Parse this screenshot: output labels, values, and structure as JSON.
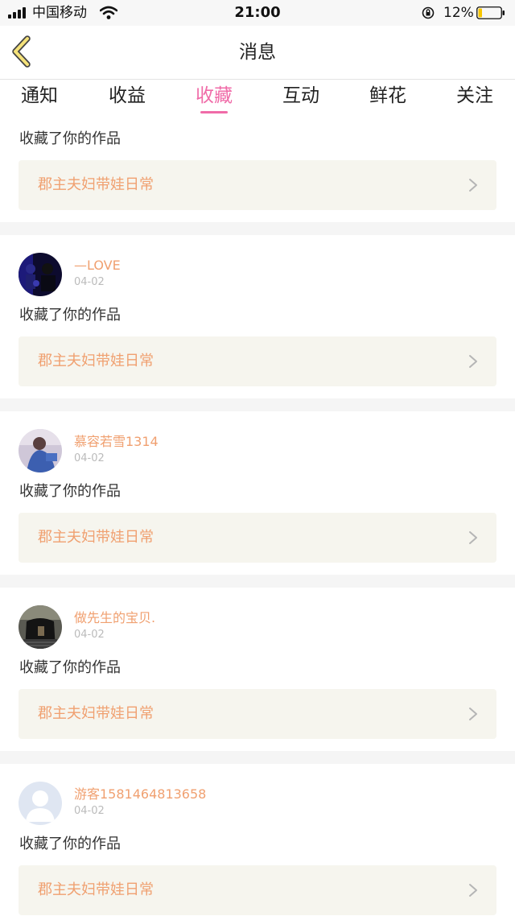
{
  "status_bar": {
    "carrier": "中国移动",
    "time": "21:00",
    "battery": "12%"
  },
  "header": {
    "title": "消息",
    "back_icon": "chevron-left-icon"
  },
  "tabs": [
    {
      "label": "通知",
      "active": false
    },
    {
      "label": "收益",
      "active": false
    },
    {
      "label": "收藏",
      "active": true
    },
    {
      "label": "互动",
      "active": false
    },
    {
      "label": "鲜花",
      "active": false
    },
    {
      "label": "关注",
      "active": false
    }
  ],
  "colors": {
    "accent_pink": "#f06ba8",
    "accent_orange": "#f0a070",
    "card_bg": "#f6f5ee"
  },
  "feed": {
    "partial_item": {
      "action": "收藏了你的作品",
      "work_title": "郡主夫妇带娃日常"
    },
    "items": [
      {
        "username": "—LOVE",
        "date": "04-02",
        "action": "收藏了你的作品",
        "work_title": "郡主夫妇带娃日常"
      },
      {
        "username": "慕容若雪1314",
        "date": "04-02",
        "action": "收藏了你的作品",
        "work_title": "郡主夫妇带娃日常"
      },
      {
        "username": "做先生的宝贝.",
        "date": "04-02",
        "action": "收藏了你的作品",
        "work_title": "郡主夫妇带娃日常"
      },
      {
        "username": "游客1581464813658",
        "date": "04-02",
        "action": "收藏了你的作品",
        "work_title": "郡主夫妇带娃日常"
      }
    ]
  }
}
